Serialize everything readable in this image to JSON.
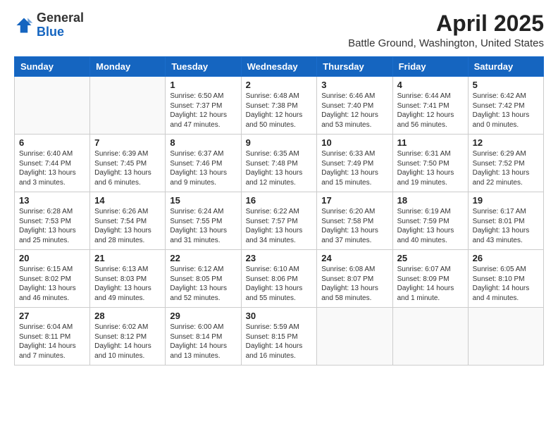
{
  "header": {
    "logo_general": "General",
    "logo_blue": "Blue",
    "main_title": "April 2025",
    "subtitle": "Battle Ground, Washington, United States"
  },
  "days_of_week": [
    "Sunday",
    "Monday",
    "Tuesday",
    "Wednesday",
    "Thursday",
    "Friday",
    "Saturday"
  ],
  "weeks": [
    [
      {
        "day": "",
        "info": ""
      },
      {
        "day": "",
        "info": ""
      },
      {
        "day": "1",
        "info": "Sunrise: 6:50 AM\nSunset: 7:37 PM\nDaylight: 12 hours and 47 minutes."
      },
      {
        "day": "2",
        "info": "Sunrise: 6:48 AM\nSunset: 7:38 PM\nDaylight: 12 hours and 50 minutes."
      },
      {
        "day": "3",
        "info": "Sunrise: 6:46 AM\nSunset: 7:40 PM\nDaylight: 12 hours and 53 minutes."
      },
      {
        "day": "4",
        "info": "Sunrise: 6:44 AM\nSunset: 7:41 PM\nDaylight: 12 hours and 56 minutes."
      },
      {
        "day": "5",
        "info": "Sunrise: 6:42 AM\nSunset: 7:42 PM\nDaylight: 13 hours and 0 minutes."
      }
    ],
    [
      {
        "day": "6",
        "info": "Sunrise: 6:40 AM\nSunset: 7:44 PM\nDaylight: 13 hours and 3 minutes."
      },
      {
        "day": "7",
        "info": "Sunrise: 6:39 AM\nSunset: 7:45 PM\nDaylight: 13 hours and 6 minutes."
      },
      {
        "day": "8",
        "info": "Sunrise: 6:37 AM\nSunset: 7:46 PM\nDaylight: 13 hours and 9 minutes."
      },
      {
        "day": "9",
        "info": "Sunrise: 6:35 AM\nSunset: 7:48 PM\nDaylight: 13 hours and 12 minutes."
      },
      {
        "day": "10",
        "info": "Sunrise: 6:33 AM\nSunset: 7:49 PM\nDaylight: 13 hours and 15 minutes."
      },
      {
        "day": "11",
        "info": "Sunrise: 6:31 AM\nSunset: 7:50 PM\nDaylight: 13 hours and 19 minutes."
      },
      {
        "day": "12",
        "info": "Sunrise: 6:29 AM\nSunset: 7:52 PM\nDaylight: 13 hours and 22 minutes."
      }
    ],
    [
      {
        "day": "13",
        "info": "Sunrise: 6:28 AM\nSunset: 7:53 PM\nDaylight: 13 hours and 25 minutes."
      },
      {
        "day": "14",
        "info": "Sunrise: 6:26 AM\nSunset: 7:54 PM\nDaylight: 13 hours and 28 minutes."
      },
      {
        "day": "15",
        "info": "Sunrise: 6:24 AM\nSunset: 7:55 PM\nDaylight: 13 hours and 31 minutes."
      },
      {
        "day": "16",
        "info": "Sunrise: 6:22 AM\nSunset: 7:57 PM\nDaylight: 13 hours and 34 minutes."
      },
      {
        "day": "17",
        "info": "Sunrise: 6:20 AM\nSunset: 7:58 PM\nDaylight: 13 hours and 37 minutes."
      },
      {
        "day": "18",
        "info": "Sunrise: 6:19 AM\nSunset: 7:59 PM\nDaylight: 13 hours and 40 minutes."
      },
      {
        "day": "19",
        "info": "Sunrise: 6:17 AM\nSunset: 8:01 PM\nDaylight: 13 hours and 43 minutes."
      }
    ],
    [
      {
        "day": "20",
        "info": "Sunrise: 6:15 AM\nSunset: 8:02 PM\nDaylight: 13 hours and 46 minutes."
      },
      {
        "day": "21",
        "info": "Sunrise: 6:13 AM\nSunset: 8:03 PM\nDaylight: 13 hours and 49 minutes."
      },
      {
        "day": "22",
        "info": "Sunrise: 6:12 AM\nSunset: 8:05 PM\nDaylight: 13 hours and 52 minutes."
      },
      {
        "day": "23",
        "info": "Sunrise: 6:10 AM\nSunset: 8:06 PM\nDaylight: 13 hours and 55 minutes."
      },
      {
        "day": "24",
        "info": "Sunrise: 6:08 AM\nSunset: 8:07 PM\nDaylight: 13 hours and 58 minutes."
      },
      {
        "day": "25",
        "info": "Sunrise: 6:07 AM\nSunset: 8:09 PM\nDaylight: 14 hours and 1 minute."
      },
      {
        "day": "26",
        "info": "Sunrise: 6:05 AM\nSunset: 8:10 PM\nDaylight: 14 hours and 4 minutes."
      }
    ],
    [
      {
        "day": "27",
        "info": "Sunrise: 6:04 AM\nSunset: 8:11 PM\nDaylight: 14 hours and 7 minutes."
      },
      {
        "day": "28",
        "info": "Sunrise: 6:02 AM\nSunset: 8:12 PM\nDaylight: 14 hours and 10 minutes."
      },
      {
        "day": "29",
        "info": "Sunrise: 6:00 AM\nSunset: 8:14 PM\nDaylight: 14 hours and 13 minutes."
      },
      {
        "day": "30",
        "info": "Sunrise: 5:59 AM\nSunset: 8:15 PM\nDaylight: 14 hours and 16 minutes."
      },
      {
        "day": "",
        "info": ""
      },
      {
        "day": "",
        "info": ""
      },
      {
        "day": "",
        "info": ""
      }
    ]
  ]
}
